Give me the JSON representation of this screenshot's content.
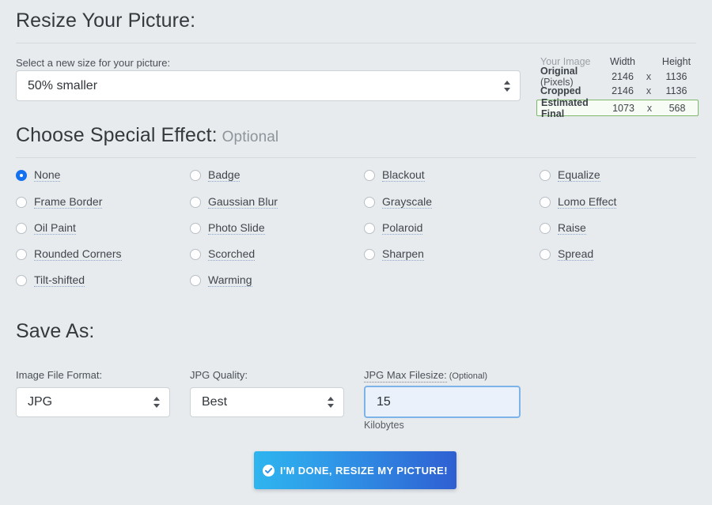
{
  "resize_section": {
    "title": "Resize Your Picture:",
    "size_label": "Select a new size for your picture:",
    "size_value": "50% smaller"
  },
  "image_info": {
    "col_name": "Your Image",
    "col_width": "Width",
    "col_height": "Height",
    "times": "x",
    "rows": [
      {
        "name_bold": "Original",
        "name_light": "(Pixels)",
        "width": "2146",
        "height": "1136"
      },
      {
        "name_bold": "Cropped",
        "name_light": "",
        "width": "2146",
        "height": "1136"
      },
      {
        "name_bold": "Estimated Final",
        "name_light": "",
        "width": "1073",
        "height": "568"
      }
    ],
    "highlight_border": "#7db96a"
  },
  "effects_section": {
    "title": "Choose Special Effect:",
    "optional": "Optional",
    "selected": "None",
    "columns": [
      [
        "None",
        "Frame Border",
        "Oil Paint",
        "Rounded Corners",
        "Tilt-shifted"
      ],
      [
        "Badge",
        "Gaussian Blur",
        "Photo Slide",
        "Scorched",
        "Warming"
      ],
      [
        "Blackout",
        "Grayscale",
        "Polaroid",
        "Sharpen"
      ],
      [
        "Equalize",
        "Lomo Effect",
        "Raise",
        "Spread"
      ]
    ]
  },
  "save_section": {
    "title": "Save As:",
    "format_label": "Image File Format:",
    "format_value": "JPG",
    "quality_label": "JPG Quality:",
    "quality_value": "Best",
    "filesize_label": "JPG Max Filesize:",
    "filesize_optional": "(Optional)",
    "filesize_value": "15",
    "filesize_units": "Kilobytes"
  },
  "submit": {
    "label": "I'M DONE, RESIZE MY PICTURE!",
    "icon": "check-circle-icon",
    "accent_start": "#2eb5ef",
    "accent_end": "#2f5fd2"
  }
}
